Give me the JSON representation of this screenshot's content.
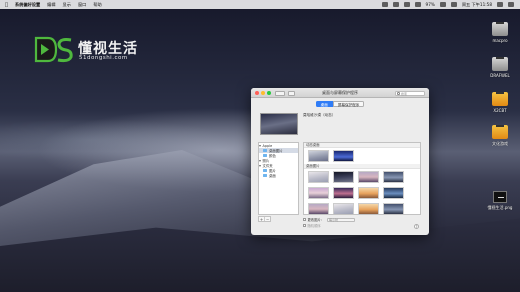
{
  "menubar": {
    "app_name": "系统偏好设置",
    "items": [
      "编辑",
      "显示",
      "窗口",
      "帮助"
    ],
    "battery": "97%",
    "clock": "周五 下午11:58"
  },
  "logo": {
    "mark": "DS",
    "name": "懂视生活",
    "url": "51dongshi.com"
  },
  "desktop_icons": [
    {
      "label": "macpro",
      "kind": "disk-gray"
    },
    {
      "label": "DRAFWEL",
      "kind": "disk-gray"
    },
    {
      "label": "X2CBT",
      "kind": "disk-orange"
    },
    {
      "label": "文化游戏",
      "kind": "disk-orange"
    },
    {
      "label": "懂视生活.png",
      "kind": "file"
    }
  ],
  "window": {
    "title": "桌面与屏幕保护程序",
    "search_placeholder": "搜索",
    "tabs": [
      {
        "label": "桌面",
        "active": true
      },
      {
        "label": "屏幕保护程序",
        "active": false
      }
    ],
    "current_wallpaper_name": "莫哈维沙漠（动态）",
    "sidebar": {
      "items": [
        {
          "label": "Apple",
          "kind": "group"
        },
        {
          "label": "桌面图片",
          "kind": "folder",
          "selected": true
        },
        {
          "label": "颜色",
          "kind": "folder"
        },
        {
          "label": "照片",
          "kind": "group"
        },
        {
          "label": "文件夹",
          "kind": "group"
        },
        {
          "label": "图片",
          "kind": "folder"
        },
        {
          "label": "桌面",
          "kind": "folder"
        }
      ],
      "add": "+",
      "remove": "−"
    },
    "sections": [
      {
        "title": "动态桌面"
      },
      {
        "title": "桌面图片"
      }
    ],
    "change_picture_label": "更改图片：",
    "interval_value": "每小时",
    "random_order_label": "随机顺序",
    "help": "?"
  },
  "colors": {
    "accent": "#2f7cf6",
    "close": "#ff5f57",
    "minimize": "#febc2e",
    "maximize": "#28c840"
  }
}
